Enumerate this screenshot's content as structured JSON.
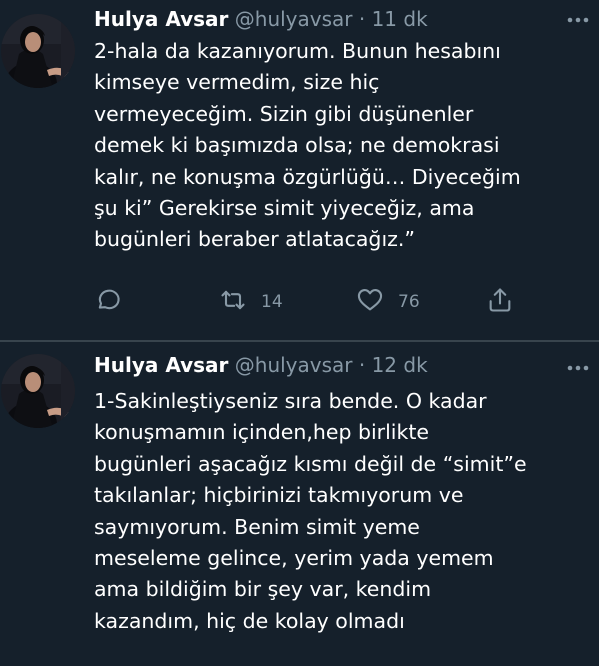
{
  "colors": {
    "background": "#15202b",
    "text": "#ffffff",
    "secondary": "#8899a6",
    "divider": "#38444d"
  },
  "tweets": [
    {
      "name": "Hulya Avsar",
      "handle": "@hulyavsar",
      "separator": "·",
      "time": "11 dk",
      "lines": [
        "2-hala da kazanıyorum. Bunun hesabını",
        "kimseye vermedim, size hiç",
        "vermeyeceğim. Sizin gibi düşünenler",
        "demek ki başımızda olsa; ne demokrasi",
        "kalır, ne konuşma özgürlüğü… Diyeceğim",
        "şu ki” Gerekirse simit yiyeceğiz, ama",
        "bugünleri beraber atlatacağız.”"
      ],
      "actions": {
        "reply_icon": "reply-icon",
        "retweet_icon": "retweet-icon",
        "retweet_count": "14",
        "like_icon": "heart-icon",
        "like_count": "76",
        "share_icon": "share-icon"
      }
    },
    {
      "name": "Hulya Avsar",
      "handle": "@hulyavsar",
      "separator": "·",
      "time": "12 dk",
      "lines": [
        "1-Sakinleştiyseniz sıra bende. O kadar",
        "konuşmamın içinden,hep birlikte",
        "bugünleri aşacağız kısmı değil de “simit”e",
        "takılanlar; hiçbirinizi takmıyorum ve",
        "saymıyorum. Benim simit yeme",
        "meseleme gelince, yerim yada yemem",
        "ama bildiğim bir şey var, kendim",
        "kazandım, hiç de kolay olmadı"
      ]
    }
  ]
}
